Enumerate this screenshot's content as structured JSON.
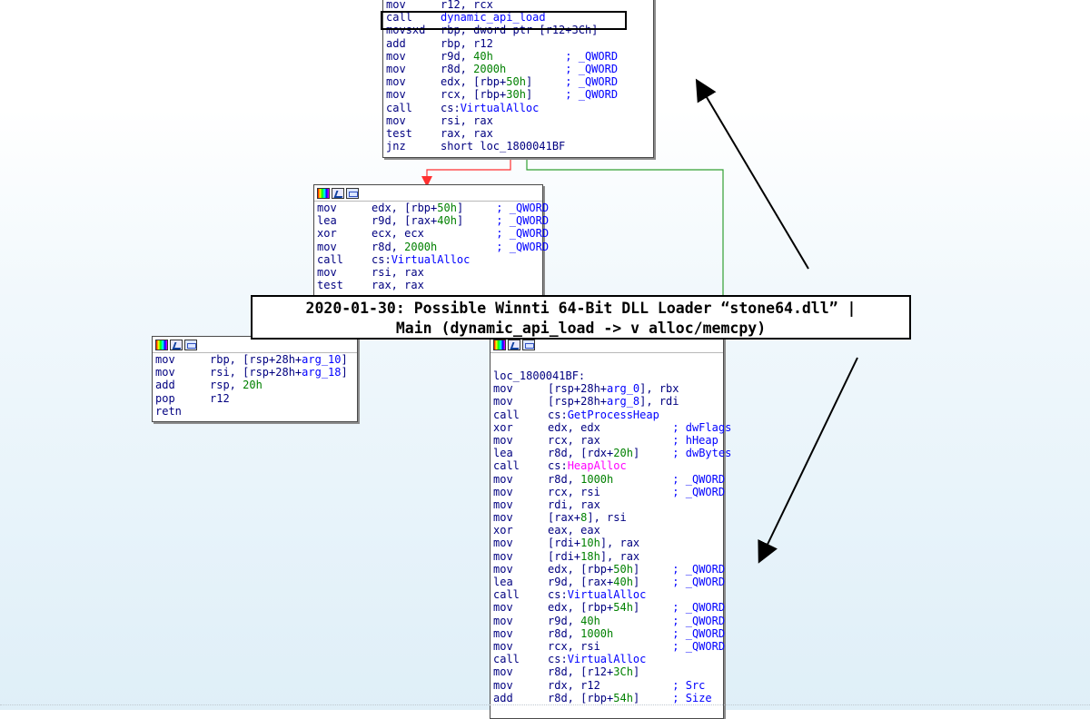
{
  "title_box": {
    "line1": "2020-01-30: Possible Winnti 64-Bit DLL Loader “stone64.dll” |",
    "line2": "Main (dynamic_api_load -> v alloc/memcpy)"
  },
  "blocks": {
    "top": {
      "lines": [
        {
          "m": "mov",
          "o": "r12, rcx"
        },
        {
          "m": "call",
          "o": "dynamic_api_load",
          "oc": "api"
        },
        {
          "m": "movsxd",
          "o": "rbp, dword ptr [r12+3Ch]"
        },
        {
          "m": "add",
          "o": "rbp, r12"
        },
        {
          "m": "mov",
          "o": "r9d, ",
          "n": "40h",
          "c": "; _QWORD"
        },
        {
          "m": "mov",
          "o": "r8d, ",
          "n": "2000h",
          "c": "; _QWORD"
        },
        {
          "m": "mov",
          "o": "edx, [rbp+",
          "n": "50h",
          "s": "]",
          "c": "; _QWORD"
        },
        {
          "m": "mov",
          "o": "rcx, [rbp+",
          "n": "30h",
          "s": "]",
          "c": "; _QWORD"
        },
        {
          "m": "call",
          "o": "cs:",
          "a": "VirtualAlloc"
        },
        {
          "m": "mov",
          "o": "rsi, rax"
        },
        {
          "m": "test",
          "o": "rax, rax"
        },
        {
          "m": "jnz",
          "o": "short loc_1800041BF"
        }
      ]
    },
    "middle": {
      "lines": [
        {
          "m": "mov",
          "o": "edx, [rbp+",
          "n": "50h",
          "s": "]",
          "c": "; _QWORD"
        },
        {
          "m": "lea",
          "o": "r9d, [rax+",
          "n": "40h",
          "s": "]",
          "c": "; _QWORD"
        },
        {
          "m": "xor",
          "o": "ecx, ecx",
          "c": "; _QWORD"
        },
        {
          "m": "mov",
          "o": "r8d, ",
          "n": "2000h",
          "c": "; _QWORD"
        },
        {
          "m": "call",
          "o": "cs:",
          "a": "VirtualAlloc"
        },
        {
          "m": "mov",
          "o": "rsi, rax"
        },
        {
          "m": "test",
          "o": "rax, rax"
        }
      ]
    },
    "left": {
      "lines": [
        {
          "m": "mov",
          "o": "rbp, [rsp+28h+",
          "a": "arg_10",
          "s": "]"
        },
        {
          "m": "mov",
          "o": "rsi, [rsp+28h+",
          "a": "arg_18",
          "s": "]"
        },
        {
          "m": "add",
          "o": "rsp, ",
          "n": "20h"
        },
        {
          "m": "pop",
          "o": "r12"
        },
        {
          "m": "retn",
          "o": ""
        }
      ]
    },
    "bottom": {
      "label": "loc_1800041BF:",
      "lines": [
        {
          "m": "mov",
          "o": "[rsp+28h+",
          "a": "arg_0",
          "s": "], rbx"
        },
        {
          "m": "mov",
          "o": "[rsp+28h+",
          "a": "arg_8",
          "s": "], rdi"
        },
        {
          "m": "call",
          "o": "cs:",
          "a": "GetProcessHeap"
        },
        {
          "m": "xor",
          "o": "edx, edx",
          "c": "; dwFlags"
        },
        {
          "m": "mov",
          "o": "rcx, rax",
          "c": "; hHeap"
        },
        {
          "m": "lea",
          "o": "r8d, [rdx+",
          "n": "20h",
          "s": "]",
          "c": "; dwBytes"
        },
        {
          "m": "call",
          "o": "cs:",
          "p": "HeapAlloc"
        },
        {
          "m": "mov",
          "o": "r8d, ",
          "n": "1000h",
          "c": "; _QWORD"
        },
        {
          "m": "mov",
          "o": "rcx, rsi",
          "c": "; _QWORD"
        },
        {
          "m": "mov",
          "o": "rdi, rax"
        },
        {
          "m": "mov",
          "o": "[rax+",
          "n": "8",
          "s": "], rsi"
        },
        {
          "m": "xor",
          "o": "eax, eax"
        },
        {
          "m": "mov",
          "o": "[rdi+",
          "n": "10h",
          "s": "], rax"
        },
        {
          "m": "mov",
          "o": "[rdi+",
          "n": "18h",
          "s": "], rax"
        },
        {
          "m": "mov",
          "o": "edx, [rbp+",
          "n": "50h",
          "s": "]",
          "c": "; _QWORD"
        },
        {
          "m": "lea",
          "o": "r9d, [rax+",
          "n": "40h",
          "s": "]",
          "c": "; _QWORD"
        },
        {
          "m": "call",
          "o": "cs:",
          "a": "VirtualAlloc"
        },
        {
          "m": "mov",
          "o": "edx, [rbp+",
          "n": "54h",
          "s": "]",
          "c": "; _QWORD"
        },
        {
          "m": "mov",
          "o": "r9d, ",
          "n": "40h",
          "c": "; _QWORD"
        },
        {
          "m": "mov",
          "o": "r8d, ",
          "n": "1000h",
          "c": "; _QWORD"
        },
        {
          "m": "mov",
          "o": "rcx, rsi",
          "c": "; _QWORD"
        },
        {
          "m": "call",
          "o": "cs:",
          "a": "VirtualAlloc"
        },
        {
          "m": "mov",
          "o": "r8d, [r12+",
          "n": "3Ch",
          "s": "]"
        },
        {
          "m": "mov",
          "o": "rdx, r12",
          "c": "; Src"
        },
        {
          "m": "add",
          "o": "r8d, [rbp+",
          "n": "54h",
          "s": "]",
          "c": "; Size"
        }
      ]
    }
  },
  "colors": {
    "edge_false": "#ff3030",
    "edge_true": "#33a033",
    "arrow": "#000000"
  }
}
